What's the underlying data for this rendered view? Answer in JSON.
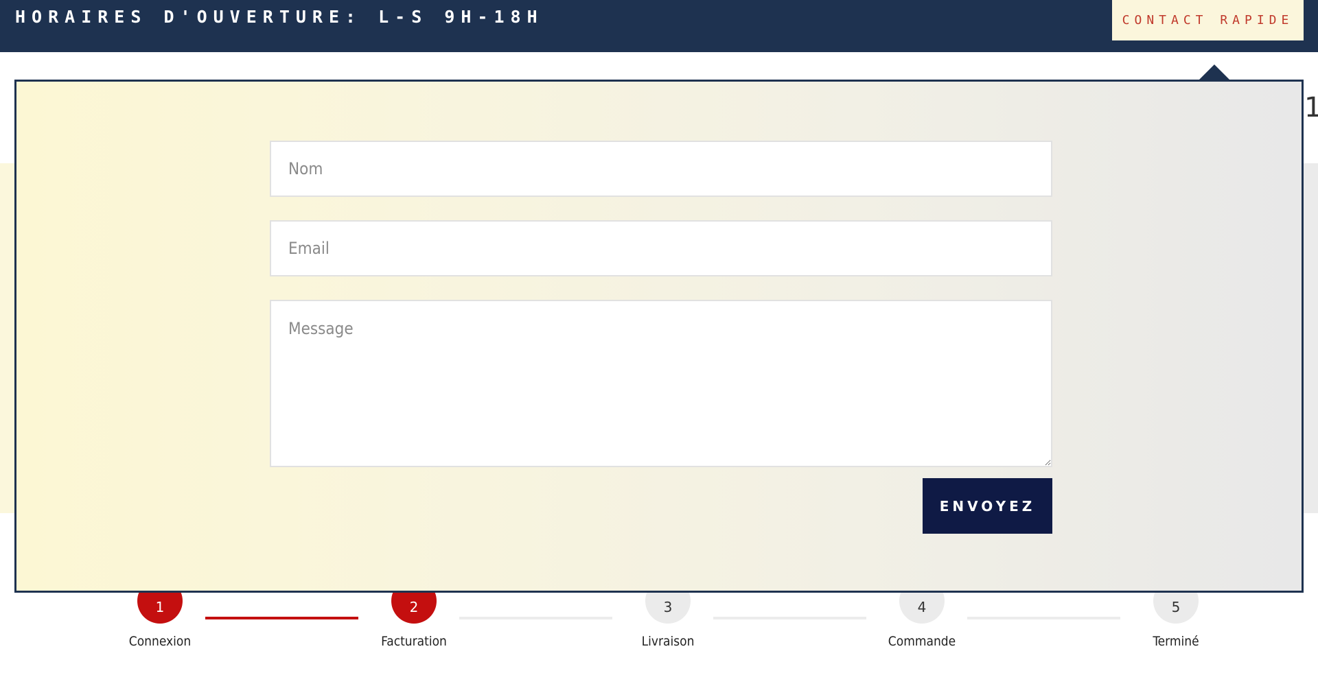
{
  "header": {
    "hours_text": "HORAIRES D'OUVERTURE: L-S 9H-18H",
    "contact_button": "CONTACT RAPIDE"
  },
  "background": {
    "partial_digit": "1"
  },
  "contact_form": {
    "name_placeholder": "Nom",
    "name_value": "",
    "email_placeholder": "Email",
    "email_value": "",
    "message_placeholder": "Message",
    "message_value": "",
    "submit_label": "ENVOYEZ"
  },
  "steps": [
    {
      "number": "1",
      "label": "Connexion",
      "completed": true
    },
    {
      "number": "2",
      "label": "Facturation",
      "completed": true
    },
    {
      "number": "3",
      "label": "Livraison",
      "completed": false
    },
    {
      "number": "4",
      "label": "Commande",
      "completed": false
    },
    {
      "number": "5",
      "label": "Terminé",
      "completed": false
    }
  ],
  "colors": {
    "header_bg": "#1e3250",
    "contact_button_bg": "#fbf6dc",
    "contact_button_text": "#c0392b",
    "submit_bg": "#0f1a45",
    "step_active": "#c40f0f",
    "step_inactive": "#ebebeb"
  }
}
